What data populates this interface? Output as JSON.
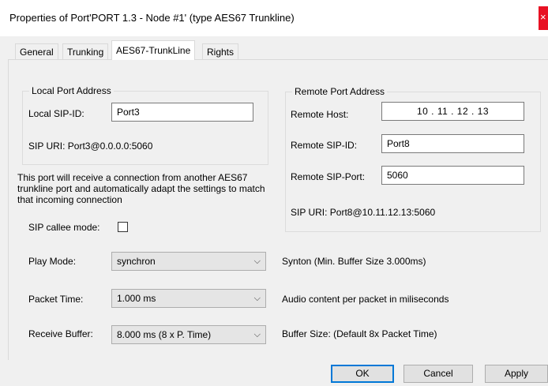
{
  "window": {
    "title": "Properties of Port'PORT 1.3 - Node #1' (type AES67 Trunkline)",
    "close_glyph": "×"
  },
  "tabs": [
    {
      "label": "General"
    },
    {
      "label": "Trunking"
    },
    {
      "label": "AES67-TrunkLine"
    },
    {
      "label": "Rights"
    }
  ],
  "local": {
    "legend": "Local Port Address",
    "sip_id_label": "Local SIP-ID:",
    "sip_id_value": "Port3",
    "sip_uri": "SIP URI: Port3@0.0.0.0:5060"
  },
  "info_text": "This port will receive a connection from another AES67 trunkline port and automatically adapt the settings to match that incoming connection",
  "callee": {
    "label": "SIP callee mode:"
  },
  "remote": {
    "legend": "Remote Port Address",
    "host_label": "Remote Host:",
    "host_value": "10   .   11   .   12   .   13",
    "sip_id_label": "Remote SIP-ID:",
    "sip_id_value": "Port8",
    "sip_port_label": "Remote SIP-Port:",
    "sip_port_value": "5060",
    "sip_uri": "SIP URI: Port8@10.11.12.13:5060"
  },
  "play_mode": {
    "label": "Play Mode:",
    "value": "synchron",
    "desc": "Synton (Min. Buffer Size 3.000ms)"
  },
  "packet_time": {
    "label": "Packet Time:",
    "value": "1.000 ms",
    "desc": "Audio content per packet in miliseconds"
  },
  "receive_buffer": {
    "label": "Receive Buffer:",
    "value": "8.000 ms (8 x P. Time)",
    "desc": "Buffer Size: (Default 8x Packet Time)"
  },
  "buttons": {
    "ok": "OK",
    "cancel": "Cancel",
    "apply": "Apply"
  },
  "icons": {
    "chevron": "⌵"
  }
}
